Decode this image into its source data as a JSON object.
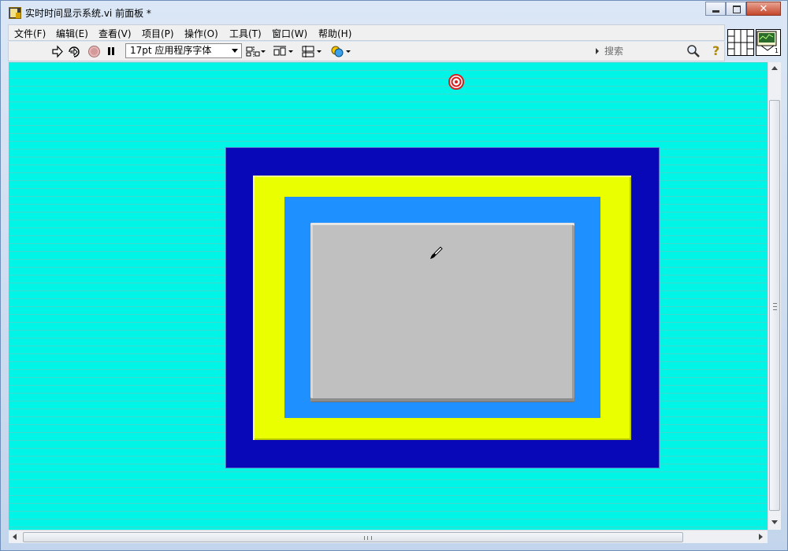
{
  "window": {
    "title": "实时时间显示系统.vi 前面板 *",
    "close_glyph": "✕"
  },
  "menu": {
    "items": [
      {
        "label": "文件(F)"
      },
      {
        "label": "编辑(E)"
      },
      {
        "label": "查看(V)"
      },
      {
        "label": "项目(P)"
      },
      {
        "label": "操作(O)"
      },
      {
        "label": "工具(T)"
      },
      {
        "label": "窗口(W)"
      },
      {
        "label": "帮助(H)"
      }
    ]
  },
  "toolbar": {
    "font_select_value": "17pt 应用程序字体",
    "search_placeholder": "搜索",
    "help_glyph": "?"
  },
  "connector": {
    "terminal_label": "1"
  },
  "colors": {
    "panel_background": "#00f5e6",
    "frame_outer": "#0808b8",
    "frame_yellow": "#eaff00",
    "frame_blue": "#1e90ff",
    "frame_gray": "#c0c0c0"
  },
  "icons": {
    "run": "run-arrow-icon",
    "run_continuous": "run-continuously-icon",
    "abort": "abort-stop-icon",
    "pause": "pause-icon",
    "align": "align-objects-icon",
    "distribute": "distribute-objects-icon",
    "resize": "resize-objects-icon",
    "reorder": "reorder-icon",
    "search": "magnifier-icon",
    "help": "context-help-icon",
    "target": "target-icon",
    "cursor": "paintbrush-cursor-icon"
  }
}
